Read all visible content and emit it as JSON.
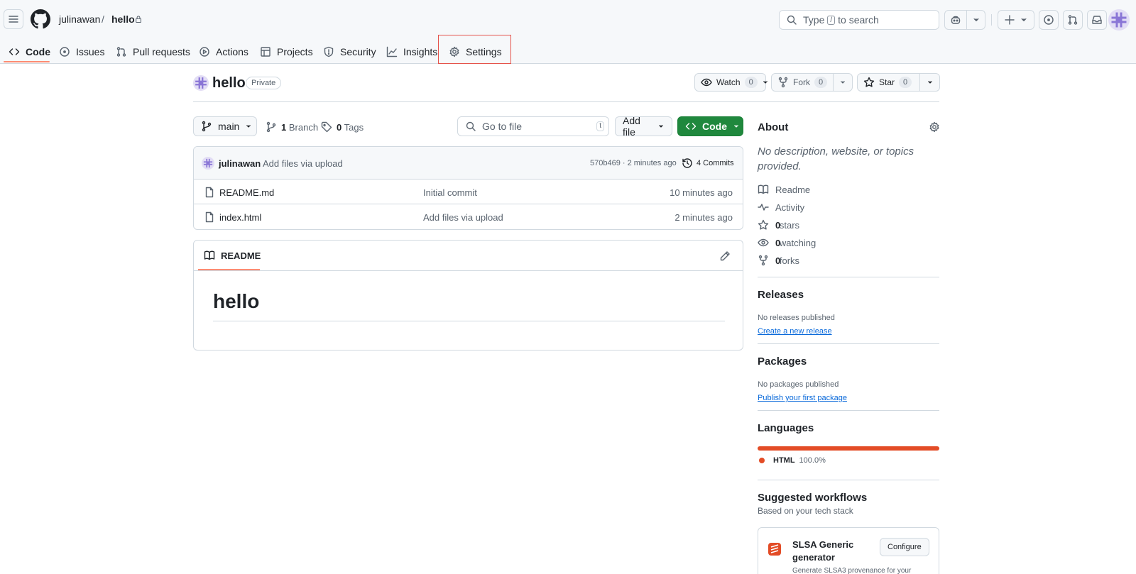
{
  "header": {
    "owner": "julinawan",
    "separator": "/",
    "repo": "hello",
    "search": {
      "prefix": "Type",
      "key": "/",
      "suffix": "to search"
    }
  },
  "tabs": [
    {
      "label": "Code",
      "icon": "code-icon"
    },
    {
      "label": "Issues",
      "icon": "issue-icon"
    },
    {
      "label": "Pull requests",
      "icon": "pull-request-icon"
    },
    {
      "label": "Actions",
      "icon": "play-icon"
    },
    {
      "label": "Projects",
      "icon": "table-icon"
    },
    {
      "label": "Security",
      "icon": "shield-icon"
    },
    {
      "label": "Insights",
      "icon": "graph-icon"
    },
    {
      "label": "Settings",
      "icon": "gear-icon"
    }
  ],
  "repo": {
    "name": "hello",
    "visibility": "Private",
    "watch": {
      "label": "Watch",
      "count": "0"
    },
    "fork": {
      "label": "Fork",
      "count": "0"
    },
    "star": {
      "label": "Star",
      "count": "0"
    }
  },
  "toolbar": {
    "branch": "main",
    "branches": {
      "count": "1",
      "label": "Branch"
    },
    "tags": {
      "count": "0",
      "label": "Tags"
    },
    "goto_placeholder": "Go to file",
    "goto_key": "t",
    "add_file": "Add file",
    "code": "Code"
  },
  "commit": {
    "author": "julinawan",
    "message": "Add files via upload",
    "sha_time": "570b469 · 2 minutes ago",
    "commits": "4 Commits"
  },
  "files": [
    {
      "name": "README.md",
      "message": "Initial commit",
      "time": "10 minutes ago"
    },
    {
      "name": "index.html",
      "message": "Add files via upload",
      "time": "2 minutes ago"
    }
  ],
  "readme": {
    "tab": "README",
    "heading": "hello"
  },
  "about": {
    "title": "About",
    "description": "No description, website, or topics provided.",
    "readme": "Readme",
    "activity": "Activity",
    "stars": {
      "count": "0",
      "label": "stars"
    },
    "watching": {
      "count": "0",
      "label": "watching"
    },
    "forks": {
      "count": "0",
      "label": "forks"
    }
  },
  "releases": {
    "title": "Releases",
    "empty": "No releases published",
    "link": "Create a new release"
  },
  "packages": {
    "title": "Packages",
    "empty": "No packages published",
    "link": "Publish your first package"
  },
  "languages": {
    "title": "Languages",
    "items": [
      {
        "name": "HTML",
        "percent": "100.0%",
        "share": 1.0,
        "color": "#e34c26"
      }
    ]
  },
  "workflows": {
    "title": "Suggested workflows",
    "subtitle": "Based on your tech stack",
    "card": {
      "name_line1": "SLSA Generic",
      "name_line2": "generator",
      "button": "Configure",
      "desc": "Generate SLSA3 provenance for your"
    }
  },
  "colors": {
    "accent_underline": "#fd8c73",
    "primary_green": "#1f883d",
    "highlight_box": "#e5534b",
    "link": "#0969da"
  }
}
